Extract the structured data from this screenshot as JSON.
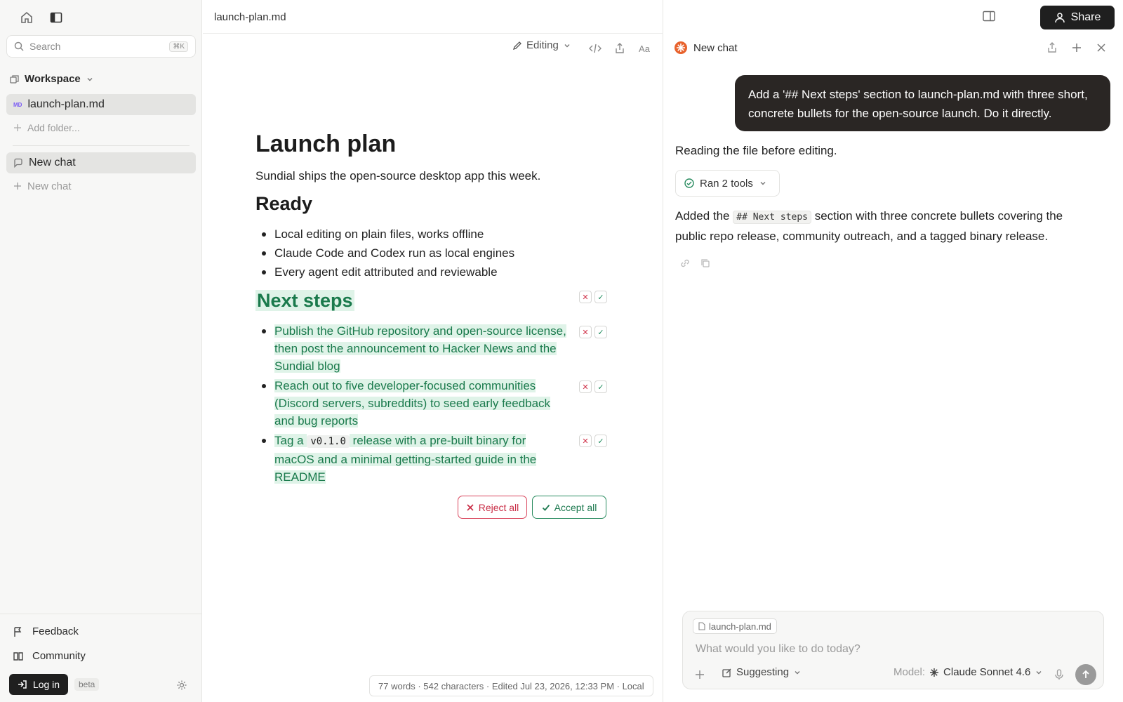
{
  "sidebar": {
    "search_placeholder": "Search",
    "search_shortcut": "⌘K",
    "workspace_label": "Workspace",
    "file_badge": "MD",
    "file_name": "launch-plan.md",
    "add_folder": "Add folder...",
    "chat_item": "New chat",
    "new_chat": "New chat",
    "feedback": "Feedback",
    "community": "Community",
    "login": "Log in",
    "beta": "beta"
  },
  "editor": {
    "tab_title": "launch-plan.md",
    "mode": "Editing",
    "title": "Launch plan",
    "intro": "Sundial ships the open-source desktop app this week.",
    "ready_heading": "Ready",
    "ready_items": [
      "Local editing on plain files, works offline",
      "Claude Code and Codex run as local engines",
      "Every agent edit attributed and reviewable"
    ],
    "next_heading": "Next steps",
    "next_items": [
      "Publish the GitHub repository and open-source license, then post the announcement to Hacker News and the Sundial blog",
      "Reach out to five developer-focused communities (Discord servers, subreddits) to seed early feedback and bug reports"
    ],
    "next_item3_a": "Tag a ",
    "next_item3_code": "v0.1.0",
    "next_item3_b": " release with a pre-built binary for macOS and a minimal getting-started guide in the README",
    "reject_all": "Reject all",
    "accept_all": "Accept all",
    "status": "77 words · 542 characters · Edited Jul 23, 2026, 12:33 PM · Local"
  },
  "chat": {
    "share": "Share",
    "title": "New chat",
    "user_message": "Add a '## Next steps' section to launch-plan.md with three short, concrete bullets for the open-source launch. Do it directly.",
    "reading": "Reading the file before editing.",
    "tools": "Ran 2 tools",
    "reply_a": "Added the ",
    "reply_code": "## Next steps",
    "reply_b": " section with three concrete bullets covering the public repo release, community outreach, and a tagged binary release.",
    "attachment": "launch-plan.md",
    "placeholder": "What would you like to do today?",
    "suggesting": "Suggesting",
    "model_label": "Model:",
    "model_name": "Claude Sonnet 4.6"
  },
  "colors": {
    "accent_green": "#1a7a4c",
    "reject_red": "#c92c45",
    "highlight": "#dff3e8"
  }
}
